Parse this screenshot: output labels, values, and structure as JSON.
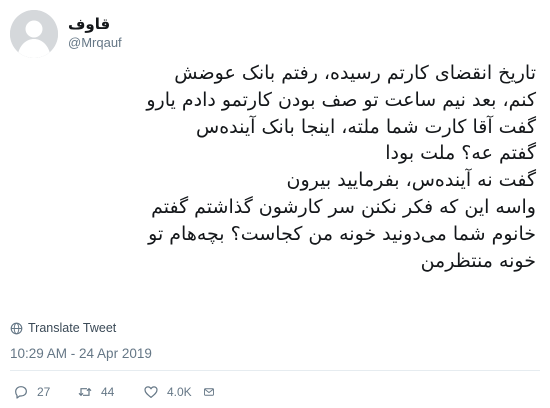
{
  "tweet": {
    "display_name": "قاوف",
    "handle": "@Mrqauf",
    "text_lines": [
      "تاریخ انقضای کارتم رسیده، رفتم بانک عوضش",
      "کنم، بعد نیم ساعت تو صف بودن کارتمو دادم یارو",
      "گفت آقا کارت شما ملته، اینجا بانک آینده‌س",
      "گفتم عه؟ ملت بودا",
      "گفت نه آینده‌س، بفرمایید بیرون",
      "واسه این که فکر نکنن سر کارشون گذاشتم گفتم",
      "خانوم شما می‌دونید خونه من کجاست؟ بچه‌هام تو",
      "خونه منتظرمن"
    ],
    "translate_label": "Translate Tweet",
    "timestamp": "10:29 AM - 24 Apr 2019"
  },
  "actions": {
    "reply_count": "27",
    "retweet_count": "44",
    "like_count": "4.0K"
  },
  "colors": {
    "text": "#14171a",
    "secondary": "#657786",
    "avatar_bg": "#d5d8db",
    "divider": "#e6ecf0"
  },
  "icons": [
    "avatar-placeholder",
    "globe-icon",
    "reply-icon",
    "retweet-icon",
    "heart-icon",
    "mail-icon"
  ]
}
